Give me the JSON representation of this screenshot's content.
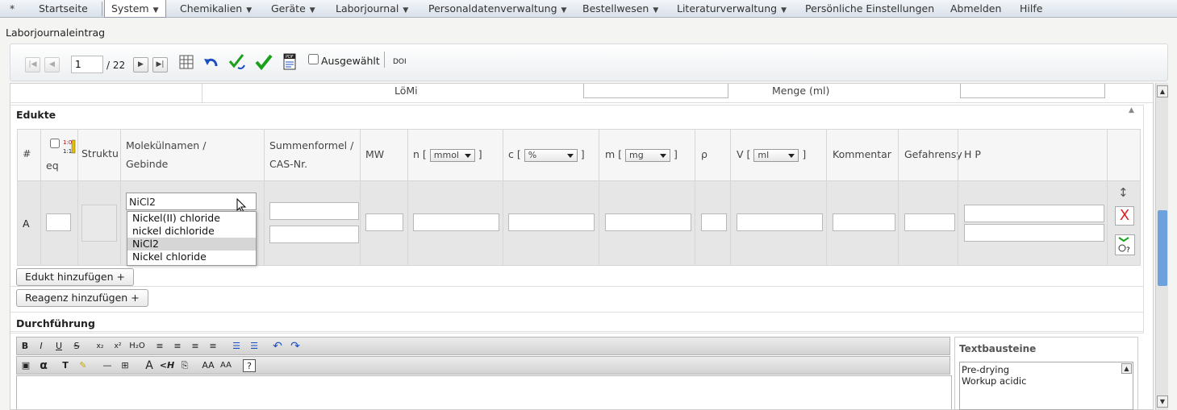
{
  "menu": {
    "star": "*",
    "items": [
      {
        "label": "Startseite"
      },
      {
        "label": "System",
        "dropdown": true,
        "active": true
      },
      {
        "label": "Chemikalien",
        "dropdown": true
      },
      {
        "label": "Geräte",
        "dropdown": true
      },
      {
        "label": "Laborjournal",
        "dropdown": true
      },
      {
        "label": "Personaldatenverwaltung",
        "dropdown": true
      },
      {
        "label": "Bestellwesen",
        "dropdown": true
      },
      {
        "label": "Literaturverwaltung",
        "dropdown": true
      },
      {
        "label": "Persönliche Einstellungen"
      },
      {
        "label": "Abmelden"
      },
      {
        "label": "Hilfe"
      }
    ]
  },
  "page_title": "Laborjournaleintrag",
  "pager": {
    "current": "1",
    "total": "/ 22",
    "selected_label": "Ausgewählt",
    "doi_label": "DOI"
  },
  "top_fields": {
    "loemi_label": "LöMi",
    "menge_label": "Menge (ml)"
  },
  "edukte": {
    "title": "Edukte",
    "columns": {
      "num": "#",
      "eq": "eq",
      "struktur": "Struktu",
      "molname": "Molekülnamen /",
      "gebinde": "Gebinde",
      "summen": "Summenformel /",
      "cas": "CAS-Nr.",
      "mw": "MW",
      "n": "n [",
      "n_unit": "mmol",
      "c": "c [",
      "c_unit": "%",
      "m": "m [",
      "m_unit": "mg",
      "rho": "ρ",
      "v": "V [",
      "v_unit": "ml",
      "close": "]",
      "kommentar": "Kommentar",
      "gefahren": "Gefahrensy",
      "hp": "H P"
    },
    "row": {
      "letter": "A",
      "molname_value": "NiCl2"
    },
    "autocomplete": [
      "Nickel(II) chloride",
      "nickel dichloride",
      "NiCl2",
      "Nickel chloride"
    ],
    "autocomplete_highlight": 2,
    "add_edukt": "Edukt hinzufügen +",
    "add_reagenz": "Reagenz hinzufügen +"
  },
  "durchfuehrung": {
    "title": "Durchführung",
    "textbausteine_title": "Textbausteine",
    "textbausteine": [
      "Pre-drying",
      "Workup acidic"
    ]
  },
  "colors": {
    "accent_green": "#1aa01a",
    "accent_blue": "#1a4fc0",
    "delete_red": "#e02020",
    "scroll_thumb": "#6ea2de"
  }
}
